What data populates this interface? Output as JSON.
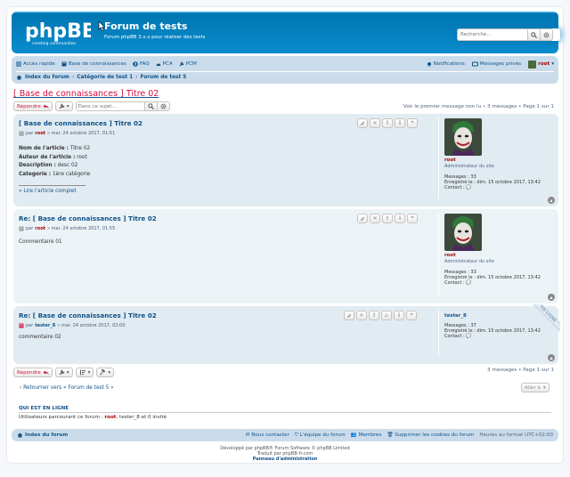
{
  "header": {
    "logo_text": "phpBB",
    "logo_sub": "creating communities",
    "site_title": "Forum de tests",
    "site_desc": "Forum phpBB 3.x.x pour réaliser des tests",
    "search_placeholder": "Recherche..."
  },
  "navbar": {
    "quick_access": "Accès rapide",
    "knowledge_base": "Base de connaissances",
    "faq": "FAQ",
    "pca": "PCA",
    "pcm": "PCM",
    "notifications": "Notifications",
    "private_messages": "Messages privés",
    "username": "root",
    "breadcrumbs": [
      "Index du forum",
      "Catégorie de test 1",
      "Forum de test 5"
    ]
  },
  "topic": {
    "title_prefix": "[ Base de connaissances ]",
    "title_text": "Titre 02",
    "reply_label": "Répondre",
    "search_placeholder": "Dans ce sujet...",
    "pagination_top": "Voir le premier message non lu • 3 messages • Page 1 sur 1",
    "pagination_bottom": "3 messages • Page 1 sur 1"
  },
  "posts": [
    {
      "title": "[ Base de connaissances ] Titre 02",
      "by": "par",
      "author": "root",
      "date": "» mar. 24 octobre 2017, 01:51",
      "body": [
        {
          "label": "Nom de l'article :",
          "value": " Titre 02"
        },
        {
          "label": "Auteur de l'article :",
          "value": " root"
        },
        {
          "label": "Description :",
          "value": " desc 02"
        },
        {
          "label": "Categorie :",
          "value": " 1ère catégorie"
        }
      ],
      "read_more": "» Lire l'article complet",
      "profile": {
        "name": "root",
        "rank": "Administrateur du site",
        "messages": "Messages : 33",
        "registered": "Enregistré le : dim. 15 octobre 2017, 13:42",
        "contact": "Contact :"
      }
    },
    {
      "title": "Re: [ Base de connaissances ] Titre 02",
      "by": "par",
      "author": "root",
      "date": "» mar. 24 octobre 2017, 01:55",
      "text": "Commentaire 01",
      "profile": {
        "name": "root",
        "rank": "Administrateur du site",
        "messages": "Messages : 33",
        "registered": "Enregistré le : dim. 15 octobre 2017, 13:42",
        "contact": "Contact :"
      }
    },
    {
      "title": "Re: [ Base de connaissances ] Titre 02",
      "by": "par",
      "author": "tester_8",
      "date": "» mar. 24 octobre 2017, 02:00",
      "text": "commentaire 02",
      "ribbon": "EN LIGNE",
      "profile": {
        "name": "tester_8",
        "messages": "Messages : 37",
        "registered": "Enregistré le : dim. 15 octobre 2017, 13:42",
        "contact": "Contact :"
      }
    }
  ],
  "return_link": "‹ Retourner vers « Forum de test 5 »",
  "jump_label": "Aller à",
  "online": {
    "title": "QUI EST EN LIGNE",
    "prefix": "Utilisateurs parcourant ce forum : ",
    "u1": "root",
    "rest": ", tester_8 et 0 invité"
  },
  "footer": {
    "home": "Index du forum",
    "contact": "Nous contacter",
    "team": "L'équipe du forum",
    "members": "Membres",
    "delete_cookies": "Supprimer les cookies du forum",
    "timezone": "Heures au format UTC+02:00",
    "powered": "Développé par phpBB® Forum Software © phpBB Limited",
    "translated": "Traduit par phpBB-fr.com",
    "admin": "Panneau d'administration"
  },
  "colors": {
    "accent": "#105289",
    "header_blue": "#12A3EB",
    "reply_red": "#d31141",
    "admin_red": "#aa0000"
  }
}
